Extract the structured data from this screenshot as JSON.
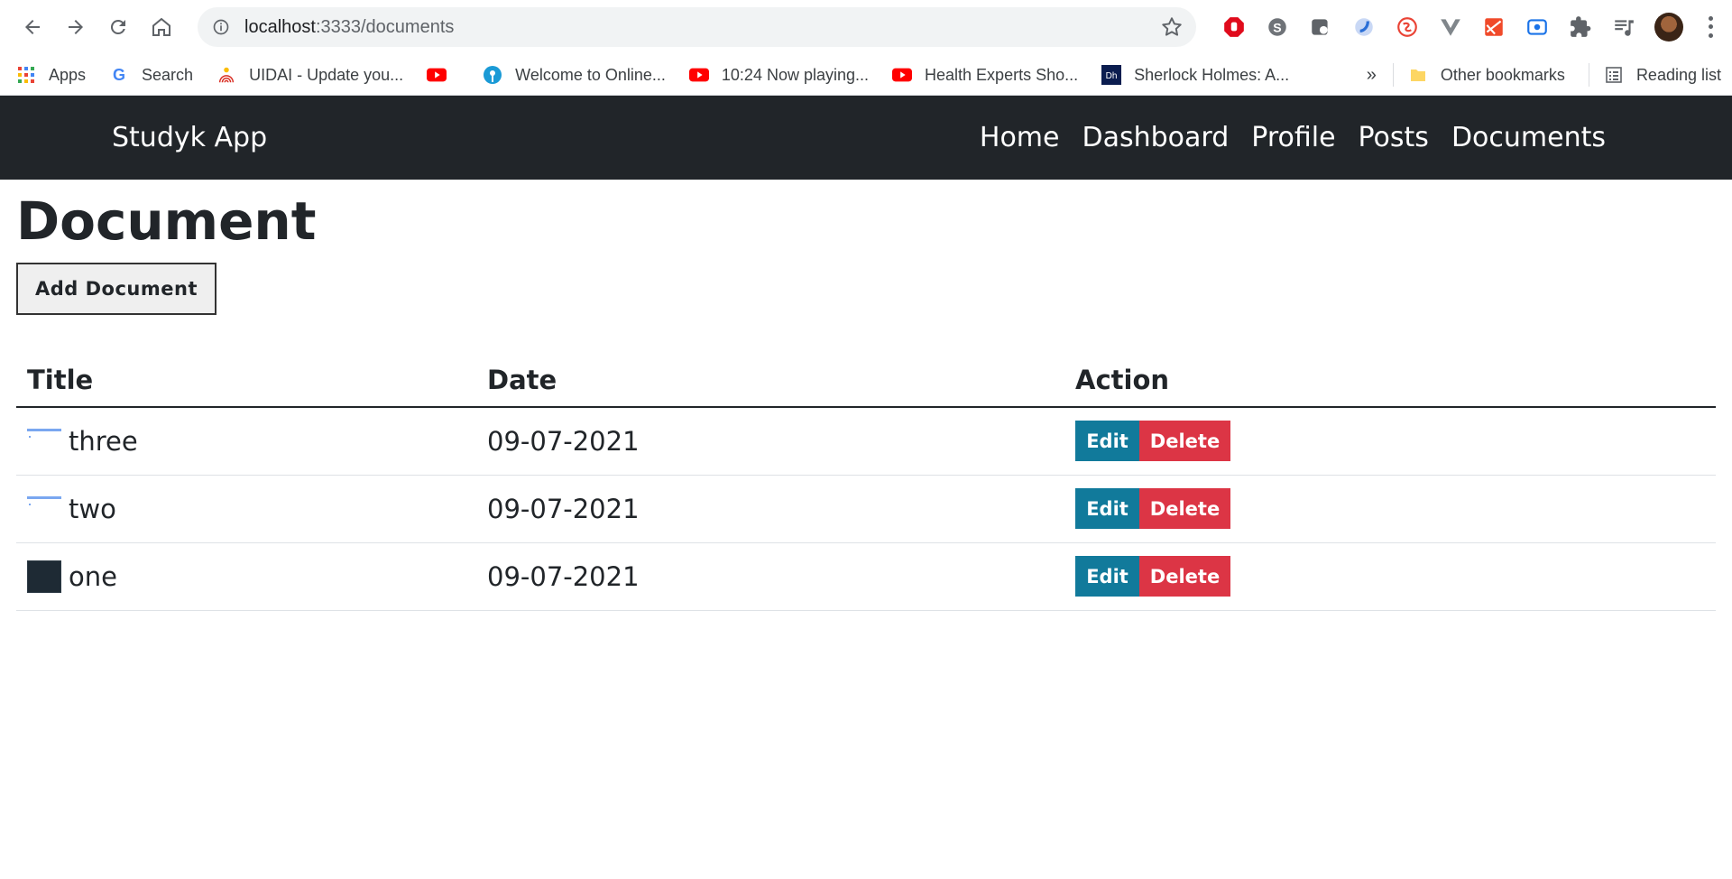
{
  "browser": {
    "url_host": "localhost",
    "url_path": ":3333/documents",
    "bookmarks": [
      {
        "label": "Apps",
        "icon": "apps-grid-icon"
      },
      {
        "label": "Search",
        "icon": "google-icon"
      },
      {
        "label": "UIDAI - Update you...",
        "icon": "uidai-icon"
      },
      {
        "label": "",
        "icon": "youtube-icon"
      },
      {
        "label": "Welcome to Online...",
        "icon": "sbi-icon"
      },
      {
        "label": "10:24 Now playing...",
        "icon": "youtube-icon"
      },
      {
        "label": "Health Experts Sho...",
        "icon": "youtube-icon"
      },
      {
        "label": "Sherlock Holmes: A...",
        "icon": "dh-icon"
      }
    ],
    "more": "»",
    "other_bookmarks": "Other bookmarks",
    "reading_list": "Reading list"
  },
  "app": {
    "brand": "Studyk App",
    "nav": [
      "Home",
      "Dashboard",
      "Profile",
      "Posts",
      "Documents"
    ]
  },
  "page": {
    "heading": "Document",
    "add_button": "Add Document"
  },
  "table": {
    "headers": [
      "Title",
      "Date",
      "Action"
    ],
    "rows": [
      {
        "title": "three",
        "date": "09-07-2021",
        "thumb": "light"
      },
      {
        "title": "two",
        "date": "09-07-2021",
        "thumb": "light"
      },
      {
        "title": "one",
        "date": "09-07-2021",
        "thumb": "dark"
      }
    ],
    "edit_label": "Edit",
    "delete_label": "Delete"
  },
  "colors": {
    "navbar": "#212529",
    "edit": "#117a9b",
    "delete": "#dc3545"
  }
}
